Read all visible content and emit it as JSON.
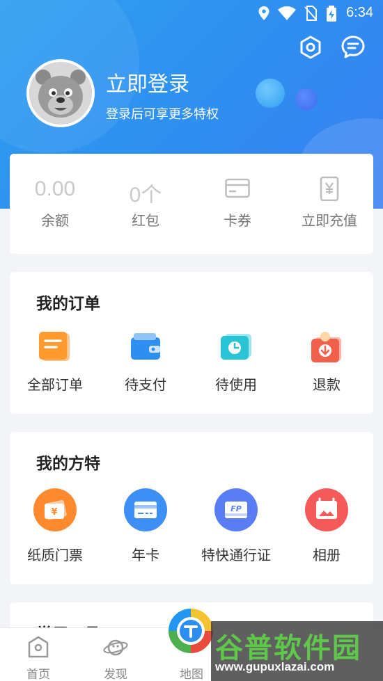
{
  "status_bar": {
    "time": "6:34"
  },
  "header": {
    "login_title": "立即登录",
    "login_subtitle": "登录后可享更多特权"
  },
  "wallet": {
    "items": [
      {
        "value": "0.00",
        "label": "余额"
      },
      {
        "value": "0个",
        "label": "红包"
      },
      {
        "icon": "card-icon",
        "label": "卡券"
      },
      {
        "icon": "yuan-phone-icon",
        "label": "立即充值"
      }
    ]
  },
  "orders": {
    "title": "我的订单",
    "items": [
      {
        "icon": "all-orders-icon",
        "label": "全部订单",
        "color": "#ff9a2e"
      },
      {
        "icon": "wallet-icon",
        "label": "待支付",
        "color": "#2e8ff0"
      },
      {
        "icon": "clock-ticket-icon",
        "label": "待使用",
        "color": "#29c5d6"
      },
      {
        "icon": "refund-icon",
        "label": "退款",
        "color": "#f0604a"
      }
    ]
  },
  "fangte": {
    "title": "我的方特",
    "items": [
      {
        "icon": "ticket-icon",
        "label": "纸质门票",
        "color": "#ff8a2e"
      },
      {
        "icon": "year-card-icon",
        "label": "年卡",
        "color": "#3d8ef5"
      },
      {
        "icon": "fp-pass-icon",
        "label": "特快通行证",
        "color": "#5a7df5",
        "badge": "FP"
      },
      {
        "icon": "album-icon",
        "label": "相册",
        "color": "#f45a5a"
      }
    ]
  },
  "tools": {
    "title": "常用工具"
  },
  "tabbar": {
    "tabs": [
      {
        "label": "首页",
        "icon": "home-icon"
      },
      {
        "label": "发现",
        "icon": "planet-icon"
      },
      {
        "label": "地图",
        "icon": "map-pin-icon"
      }
    ]
  },
  "watermark": {
    "name": "谷普软件园",
    "url": "www.gupuxlazai.com"
  }
}
